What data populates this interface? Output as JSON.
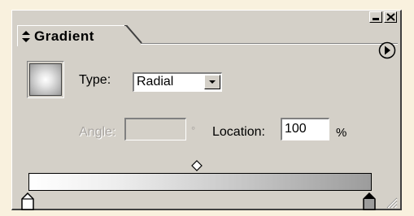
{
  "panel": {
    "tab_label": "Gradient",
    "window_buttons": [
      "minimize",
      "close"
    ]
  },
  "gradient": {
    "type_label": "Type:",
    "type_value": "Radial",
    "angle_label": "Angle:",
    "angle_value": "",
    "degree_symbol": "°",
    "location_label": "Location:",
    "location_value": "100",
    "percent_symbol": "%"
  },
  "stops": [
    {
      "name": "left",
      "color": "#ffffff",
      "selected": false
    },
    {
      "name": "right",
      "color": "#9c9c9c",
      "selected": true
    }
  ],
  "colors": {
    "panel_bg": "#d4d0c8",
    "page_bg": "#f9f1de"
  }
}
